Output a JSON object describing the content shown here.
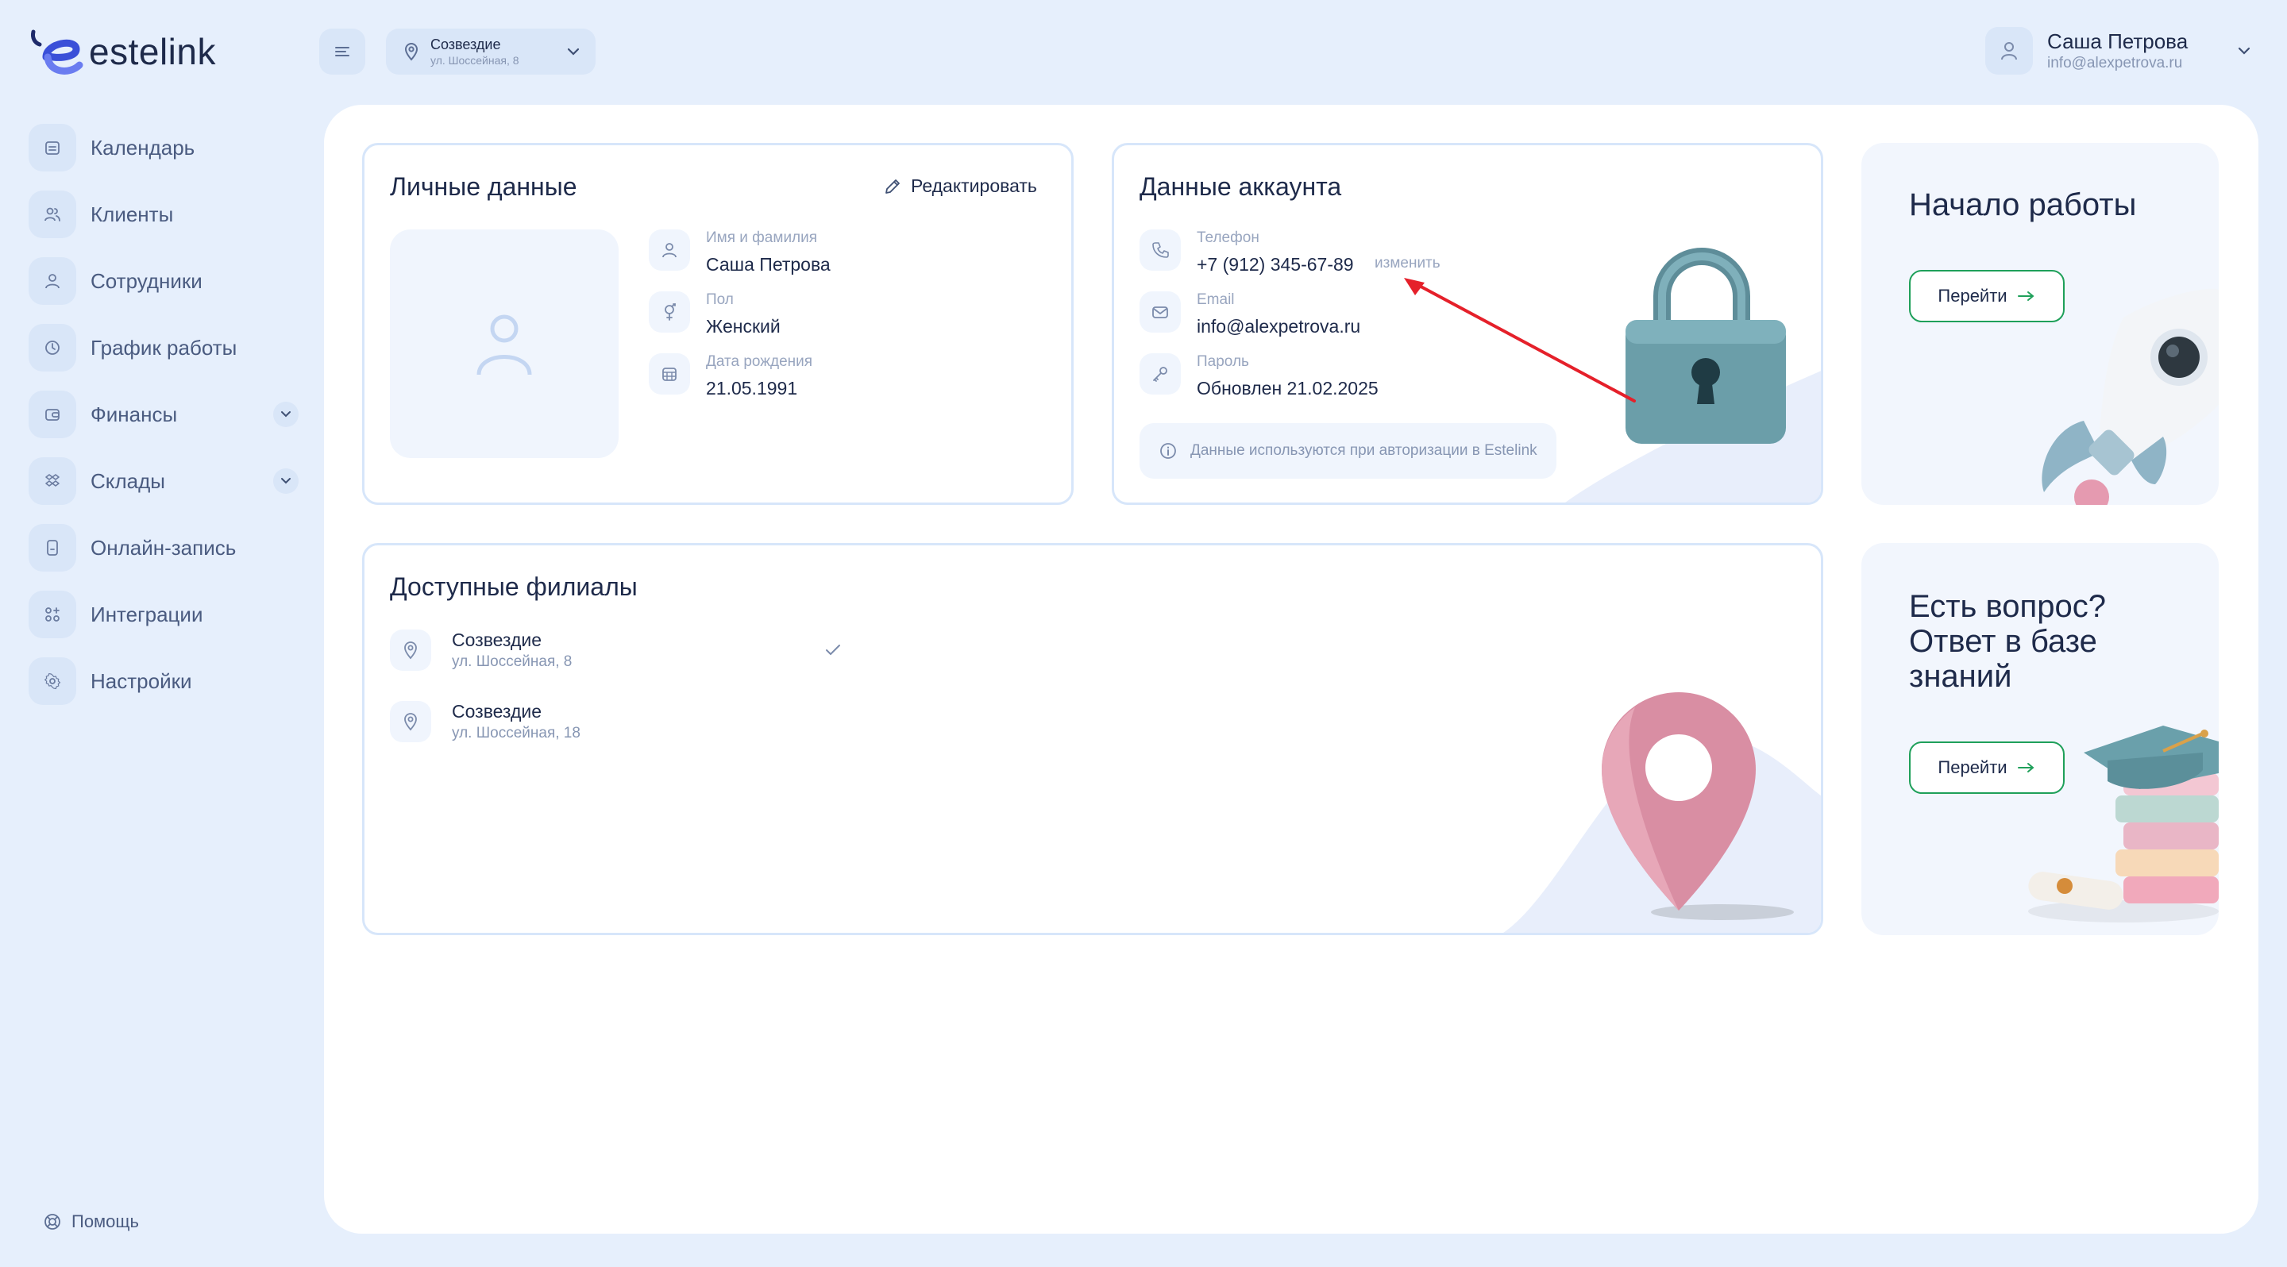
{
  "app": {
    "logo_text": "estelink"
  },
  "topbar": {
    "branch_name": "Созвездие",
    "branch_address": "ул. Шоссейная, 8"
  },
  "user": {
    "name": "Саша Петрова",
    "email": "info@alexpetrova.ru"
  },
  "sidebar": {
    "items": [
      {
        "label": "Календарь",
        "icon": "calendar-icon"
      },
      {
        "label": "Клиенты",
        "icon": "users-icon"
      },
      {
        "label": "Сотрудники",
        "icon": "user-icon"
      },
      {
        "label": "График работы",
        "icon": "clock-icon"
      },
      {
        "label": "Финансы",
        "icon": "wallet-icon",
        "expandable": true
      },
      {
        "label": "Склады",
        "icon": "boxes-icon",
        "expandable": true
      },
      {
        "label": "Онлайн-запись",
        "icon": "device-icon"
      },
      {
        "label": "Интеграции",
        "icon": "grid-plus-icon"
      },
      {
        "label": "Настройки",
        "icon": "gear-icon"
      }
    ],
    "help_label": "Помощь"
  },
  "personal": {
    "title": "Личные данные",
    "edit_label": "Редактировать",
    "fields": [
      {
        "label": "Имя и фамилия",
        "value": "Саша Петрова"
      },
      {
        "label": "Пол",
        "value": "Женский"
      },
      {
        "label": "Дата рождения",
        "value": "21.05.1991"
      }
    ]
  },
  "account": {
    "title": "Данные аккаунта",
    "phone_label": "Телефон",
    "phone_value": "+7 (912) 345-67-89",
    "change_label": "изменить",
    "email_label": "Email",
    "email_value": "info@alexpetrova.ru",
    "password_label": "Пароль",
    "password_value": "Обновлен 21.02.2025",
    "info_note": "Данные используются при авторизации в Estelink"
  },
  "branches": {
    "title": "Доступные филиалы",
    "items": [
      {
        "name": "Созвездие",
        "address": "ул. Шоссейная, 8",
        "selected": true
      },
      {
        "name": "Созвездие",
        "address": "ул. Шоссейная, 18",
        "selected": false
      }
    ]
  },
  "promo_start": {
    "title": "Начало работы",
    "button": "Перейти"
  },
  "promo_kb": {
    "title_l1": "Есть вопрос?",
    "title_l2": "Ответ в базе",
    "title_l3": "знаний",
    "button": "Перейти"
  },
  "colors": {
    "accent_green": "#1fa05a",
    "annotation_red": "#e5202a",
    "bg": "#e6effc"
  }
}
